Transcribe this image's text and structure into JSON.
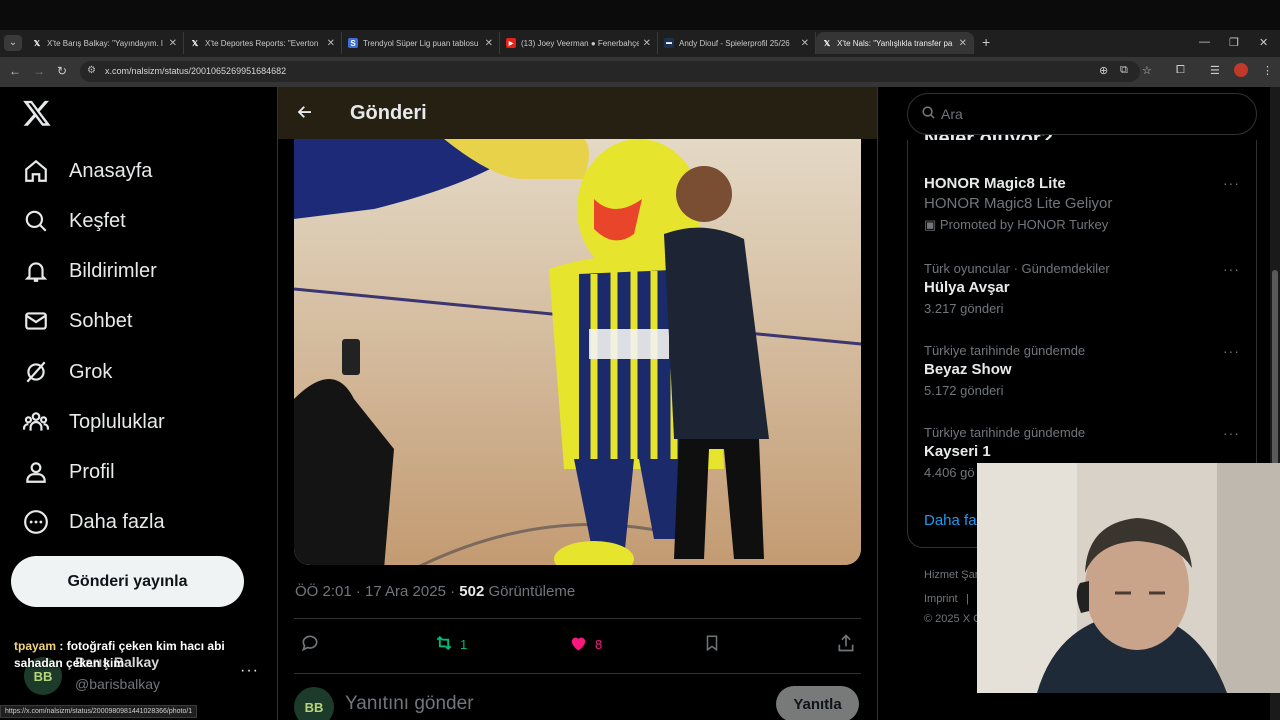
{
  "browser": {
    "tabs": [
      {
        "title": "X'te Barış Balkay: \"Yayındayım. l",
        "favicon": "x-icon",
        "active": false
      },
      {
        "title": "X'te Deportes Reports: \"Everton",
        "favicon": "x-icon",
        "active": false
      },
      {
        "title": "Trendyol Süper Lig puan tablosu",
        "favicon": "site-icon",
        "active": false
      },
      {
        "title": "(13) Joey Veerman ● Fenerbahçe",
        "favicon": "youtube-icon",
        "active": false
      },
      {
        "title": "Andy Diouf - Spielerprofil 25/26",
        "favicon": "transfermarkt-icon",
        "active": false
      },
      {
        "title": "X'te Nals: \"Yanlışlıkla transfer pa",
        "favicon": "x-icon",
        "active": true
      }
    ],
    "url": "x.com/nalsizm/status/2001065269951684682",
    "status_url": "https://x.com/nalsizm/status/2000980981441028366/photo/1"
  },
  "nav": {
    "items": [
      {
        "label": "Anasayfa",
        "icon": "home-icon"
      },
      {
        "label": "Keşfet",
        "icon": "search-icon"
      },
      {
        "label": "Bildirimler",
        "icon": "bell-icon"
      },
      {
        "label": "Sohbet",
        "icon": "mail-icon"
      },
      {
        "label": "Grok",
        "icon": "grok-icon"
      },
      {
        "label": "Topluluklar",
        "icon": "communities-icon"
      },
      {
        "label": "Profil",
        "icon": "person-icon"
      },
      {
        "label": "Daha fazla",
        "icon": "more-circle-icon"
      }
    ],
    "post_button": "Gönderi yayınla",
    "account": {
      "name": "Barış Balkay",
      "handle": "@barisbalkay",
      "initials": "BB"
    }
  },
  "chat_overlay": {
    "user": "tpayam",
    "message": " : fotoğrafi çeken kim hacı abi sahadan çeken kim"
  },
  "post": {
    "header_title": "Gönderi",
    "time": "ÖÖ 2:01 · 17 Ara 2025 · ",
    "views": "502",
    "views_label": " Görüntüleme",
    "retweets": "1",
    "likes": "8",
    "reply_placeholder": "Yanıtını gönder",
    "reply_button": "Yanıtla"
  },
  "sidebar": {
    "search_placeholder": "Ara",
    "trends_heading": "Neler oluyor?",
    "promoted": {
      "name": "HONOR Magic8 Lite",
      "subtitle": "HONOR Magic8 Lite Geliyor",
      "promoted_by": "Promoted by HONOR Turkey"
    },
    "trends": [
      {
        "context": "Türk oyuncular · Gündemdekiler",
        "name": "Hülya Avşar",
        "count": "3.217 gönderi"
      },
      {
        "context": "Türkiye tarihinde gündemde",
        "name": "Beyaz Show",
        "count": "5.172 gönderi"
      },
      {
        "context": "Türkiye tarihinde gündemde",
        "name": "Kayseri 1",
        "count": "4.406 gö"
      }
    ],
    "show_more": "Daha fa",
    "footer": {
      "terms": "Hizmet Şar",
      "imprint": "Imprint",
      "divider": "|",
      "copyright": "© 2025 X C"
    }
  },
  "colors": {
    "accent": "#1d9bf0",
    "retweet": "#00ba7c",
    "like": "#f91880",
    "bg": "#000000"
  }
}
